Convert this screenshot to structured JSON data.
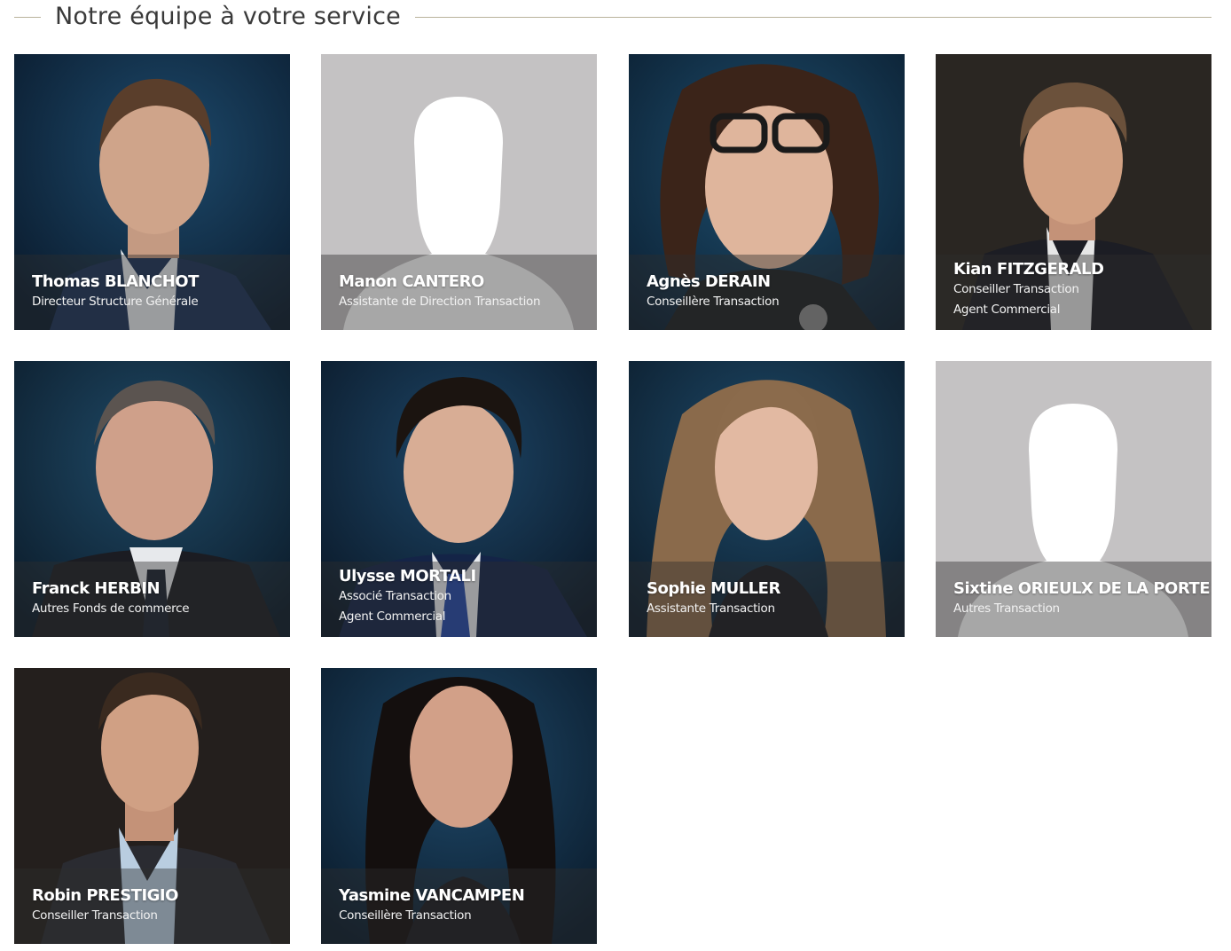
{
  "section": {
    "title": "Notre équipe à votre service"
  },
  "team": [
    {
      "name": "Thomas BLANCHOT",
      "roles": [
        "Directeur Structure Générale"
      ],
      "photo": "portrait"
    },
    {
      "name": "Manon CANTERO",
      "roles": [
        "Assistante de Direction Transaction"
      ],
      "photo": "placeholder-silhouette"
    },
    {
      "name": "Agnès DERAIN",
      "roles": [
        "Conseillère Transaction"
      ],
      "photo": "portrait"
    },
    {
      "name": "Kian FITZGERALD",
      "roles": [
        "Conseiller Transaction",
        "Agent Commercial"
      ],
      "photo": "portrait"
    },
    {
      "name": "Franck HERBIN",
      "roles": [
        "Autres Fonds de commerce"
      ],
      "photo": "portrait"
    },
    {
      "name": "Ulysse MORTALI",
      "roles": [
        "Associé Transaction",
        "Agent Commercial"
      ],
      "photo": "portrait"
    },
    {
      "name": "Sophie MULLER",
      "roles": [
        "Assistante Transaction"
      ],
      "photo": "portrait"
    },
    {
      "name": "Sixtine ORIEULX DE LA PORTE",
      "roles": [
        "Autres Transaction"
      ],
      "photo": "placeholder-silhouette"
    },
    {
      "name": "Robin PRESTIGIO",
      "roles": [
        "Conseiller Transaction"
      ],
      "photo": "portrait"
    },
    {
      "name": "Yasmine VANCAMPEN",
      "roles": [
        "Conseillère Transaction"
      ],
      "photo": "portrait"
    }
  ]
}
